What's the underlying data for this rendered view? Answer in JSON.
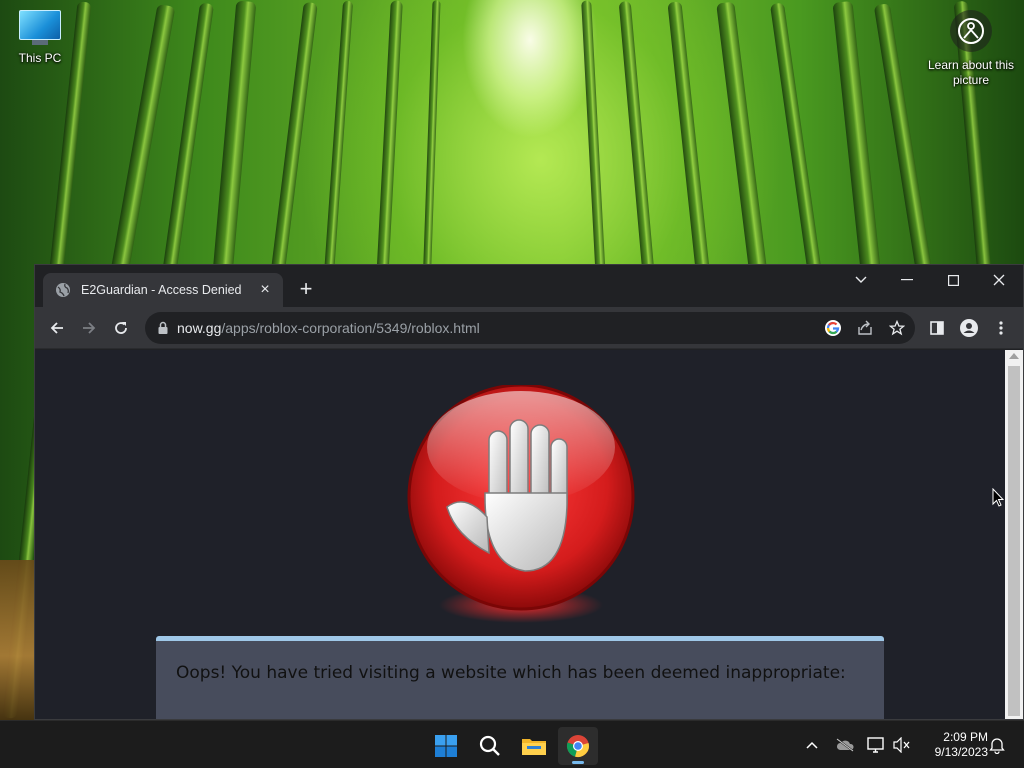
{
  "desktop": {
    "icons": [
      {
        "label": "This PC",
        "icon": "computer-icon"
      }
    ],
    "learn_about": {
      "label": "Learn about this picture",
      "icon": "learn-picture-icon"
    }
  },
  "browser": {
    "tab": {
      "title": "E2Guardian - Access Denied",
      "favicon": "globe-icon",
      "close_label": "×"
    },
    "new_tab_label": "+",
    "url_host": "now.gg",
    "url_path": "/apps/roblox-corporation/5349/roblox.html",
    "toolbar_icons": [
      "back-icon",
      "forward-icon",
      "reload-icon",
      "lock-icon",
      "google-icon",
      "share-icon",
      "bookmark-star-icon",
      "side-panel-icon",
      "profile-icon",
      "menu-icon"
    ],
    "window_controls": [
      "tab-search-icon",
      "minimize-icon",
      "maximize-icon",
      "close-icon"
    ]
  },
  "page": {
    "message": "Oops! You have tried visiting a website which has been deemed inappropriate:",
    "image": "stop-hand-icon"
  },
  "taskbar": {
    "apps": [
      "start-icon",
      "search-icon",
      "file-explorer-icon",
      "chrome-icon"
    ],
    "tray": [
      "chevron-up-icon",
      "onedrive-icon",
      "network-icon",
      "volume-muted-icon",
      "notification-icon"
    ],
    "time": "2:09 PM",
    "date": "9/13/2023"
  },
  "colors": {
    "browser_bg": "#202124",
    "toolbar_bg": "#35363a",
    "page_bg": "#1f2129",
    "notice_bg": "#474c5c",
    "notice_accent": "#9fc8e8",
    "taskbar_bg": "#1c1c1c",
    "stop_red": "#d41c1c"
  }
}
